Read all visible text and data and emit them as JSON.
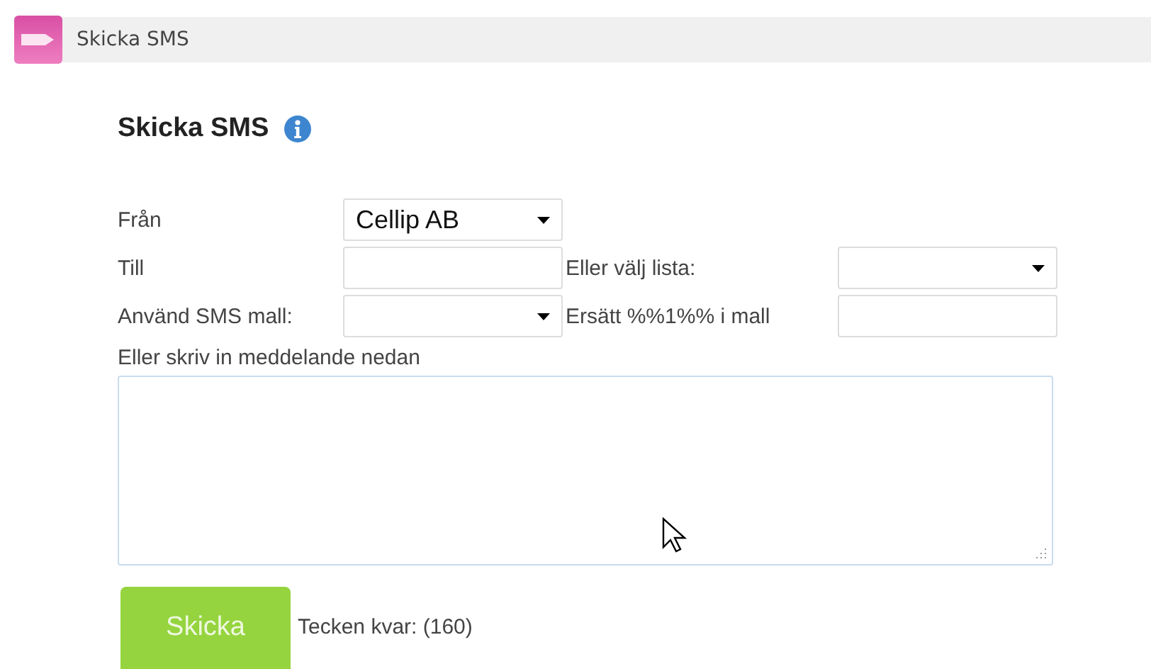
{
  "tab": {
    "title": "Skicka SMS"
  },
  "heading": "Skicka SMS",
  "fields": [
    {
      "kind": "select",
      "label": "Från",
      "value": "Cellip AB"
    },
    {
      "kind": "input",
      "label": "Till"
    },
    {
      "kind": "select",
      "label": "Eller välj lista:"
    },
    {
      "kind": "select",
      "label": "Använd SMS mall:"
    },
    {
      "kind": "input",
      "label": "Ersätt %%1%% i mall"
    }
  ],
  "message_label": "Eller skriv in meddelande nedan",
  "send_button": "Skicka",
  "counter": "Tecken kvar: (160)"
}
